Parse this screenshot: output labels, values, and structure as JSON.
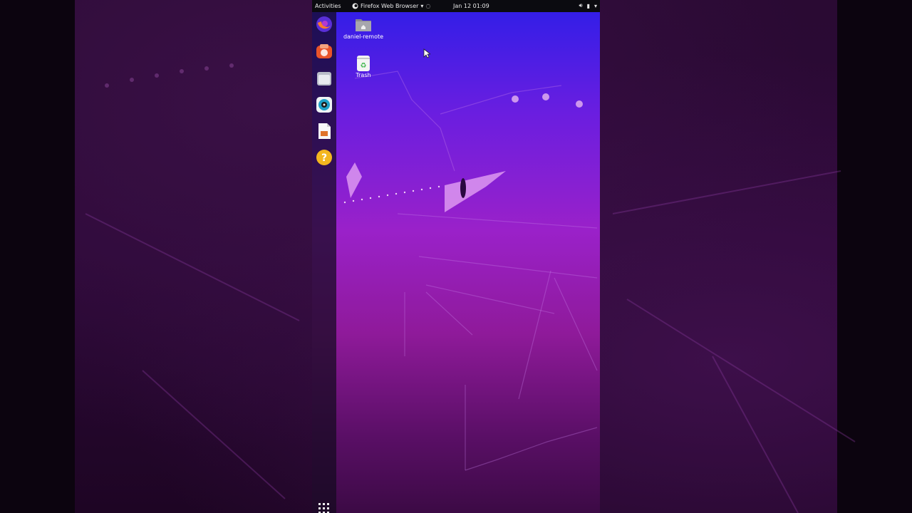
{
  "topbar": {
    "activities": "Activities",
    "app_menu_label": "Firefox Web Browser",
    "clock": "Jan 12  01:09",
    "tray_icons": [
      "volume-icon",
      "battery-icon",
      "system-menu-chevron-icon"
    ]
  },
  "dock": {
    "items": [
      {
        "name": "firefox",
        "icon": "firefox-icon"
      },
      {
        "name": "ubuntu-software",
        "icon": "ubuntu-software-icon"
      },
      {
        "name": "files",
        "icon": "files-folder-icon"
      },
      {
        "name": "rhythmbox",
        "icon": "rhythmbox-icon"
      },
      {
        "name": "libreoffice-impress",
        "icon": "libreoffice-impress-icon"
      },
      {
        "name": "help",
        "icon": "help-icon"
      }
    ],
    "show_apps_icon": "show-applications-grid-icon"
  },
  "desktop": {
    "icons": [
      {
        "label": "daniel-remote",
        "icon": "home-folder-icon"
      },
      {
        "label": "Trash",
        "icon": "trash-icon"
      }
    ]
  },
  "colors": {
    "wallpaper_top": "#2d1ee8",
    "wallpaper_mid": "#9a21c9",
    "wallpaper_bottom": "#3c0a45",
    "topbar": "#0b0b10"
  }
}
